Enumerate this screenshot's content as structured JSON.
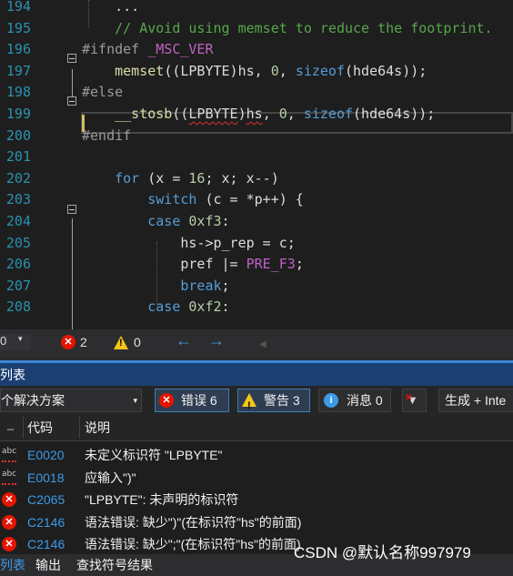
{
  "editor": {
    "lines": [
      {
        "n": "194",
        "code": [
          {
            "t": "    ",
            "c": "plain"
          },
          {
            "t": "...",
            "c": "plain"
          }
        ]
      },
      {
        "n": "195",
        "code": [
          {
            "t": "    // Avoid using memset to reduce the footprint.",
            "c": "com"
          }
        ]
      },
      {
        "n": "196",
        "code": [
          {
            "t": "#ifndef ",
            "c": "pp"
          },
          {
            "t": "_MSC_VER",
            "c": "mac"
          }
        ]
      },
      {
        "n": "197",
        "code": [
          {
            "t": "    ",
            "c": "plain"
          },
          {
            "t": "memset",
            "c": "fn"
          },
          {
            "t": "((LPBYTE)hs, ",
            "c": "plain"
          },
          {
            "t": "0",
            "c": "num"
          },
          {
            "t": ", ",
            "c": "plain"
          },
          {
            "t": "sizeof",
            "c": "kw"
          },
          {
            "t": "(hde64s));",
            "c": "plain"
          }
        ]
      },
      {
        "n": "198",
        "code": [
          {
            "t": "#else",
            "c": "pp"
          }
        ]
      },
      {
        "n": "199",
        "code": [
          {
            "t": "    ",
            "c": "plain"
          },
          {
            "t": "__stosb",
            "c": "fn"
          },
          {
            "t": "((",
            "c": "plain"
          },
          {
            "t": "LPBYTE",
            "c": "plain",
            "squig": true
          },
          {
            "t": ")",
            "c": "plain"
          },
          {
            "t": "hs",
            "c": "plain",
            "squig": true
          },
          {
            "t": ", ",
            "c": "plain"
          },
          {
            "t": "0",
            "c": "num"
          },
          {
            "t": ", ",
            "c": "plain"
          },
          {
            "t": "sizeof",
            "c": "kw"
          },
          {
            "t": "(hde64s));",
            "c": "plain"
          }
        ]
      },
      {
        "n": "200",
        "code": [
          {
            "t": "#endif",
            "c": "pp"
          }
        ]
      },
      {
        "n": "201",
        "code": []
      },
      {
        "n": "202",
        "code": [
          {
            "t": "    ",
            "c": "plain"
          },
          {
            "t": "for",
            "c": "kw"
          },
          {
            "t": " (x = ",
            "c": "plain"
          },
          {
            "t": "16",
            "c": "num"
          },
          {
            "t": "; x; x--)",
            "c": "plain"
          }
        ]
      },
      {
        "n": "203",
        "code": [
          {
            "t": "        ",
            "c": "plain"
          },
          {
            "t": "switch",
            "c": "kw"
          },
          {
            "t": " (c = *p++) {",
            "c": "plain"
          }
        ]
      },
      {
        "n": "204",
        "code": [
          {
            "t": "        ",
            "c": "plain"
          },
          {
            "t": "case",
            "c": "kw"
          },
          {
            "t": " ",
            "c": "plain"
          },
          {
            "t": "0xf3",
            "c": "num"
          },
          {
            "t": ":",
            "c": "plain"
          }
        ]
      },
      {
        "n": "205",
        "code": [
          {
            "t": "            hs->p_rep = c;",
            "c": "plain"
          }
        ]
      },
      {
        "n": "206",
        "code": [
          {
            "t": "            pref |= ",
            "c": "plain"
          },
          {
            "t": "PRE_F3",
            "c": "mac"
          },
          {
            "t": ";",
            "c": "plain"
          }
        ]
      },
      {
        "n": "207",
        "code": [
          {
            "t": "            ",
            "c": "plain"
          },
          {
            "t": "break",
            "c": "kw"
          },
          {
            "t": ";",
            "c": "plain"
          }
        ]
      },
      {
        "n": "208",
        "code": [
          {
            "t": "        ",
            "c": "plain"
          },
          {
            "t": "case",
            "c": "kw"
          },
          {
            "t": " ",
            "c": "plain"
          },
          {
            "t": "0xf2",
            "c": "num"
          },
          {
            "t": ":",
            "c": "plain"
          }
        ]
      }
    ]
  },
  "status_bar": {
    "zoom_value": "0",
    "error_count": "2",
    "warning_count": "0"
  },
  "error_list": {
    "title": "列表",
    "scope_dropdown": "个解决方案",
    "errors_button": "错误 6",
    "warnings_button": "警告 3",
    "messages_button": "消息 0",
    "build_dropdown": "生成 + Inte",
    "columns": {
      "code": "代码",
      "description": "说明"
    },
    "rows": [
      {
        "icon": "abc",
        "code": "E0020",
        "desc": "未定义标识符 \"LPBYTE\""
      },
      {
        "icon": "abc",
        "code": "E0018",
        "desc": "应输入\")\""
      },
      {
        "icon": "error",
        "code": "C2065",
        "desc": "\"LPBYTE\": 未声明的标识符"
      },
      {
        "icon": "error",
        "code": "C2146",
        "desc": "语法错误: 缺少\")\"(在标识符\"hs\"的前面)"
      },
      {
        "icon": "error",
        "code": "C2146",
        "desc": "语法错误: 缺少\";\"(在标识符\"hs\"的前面)"
      }
    ]
  },
  "bottom_tabs": [
    "列表",
    "输出",
    "查找符号结果"
  ],
  "watermark": "CSDN @默认名称997979"
}
